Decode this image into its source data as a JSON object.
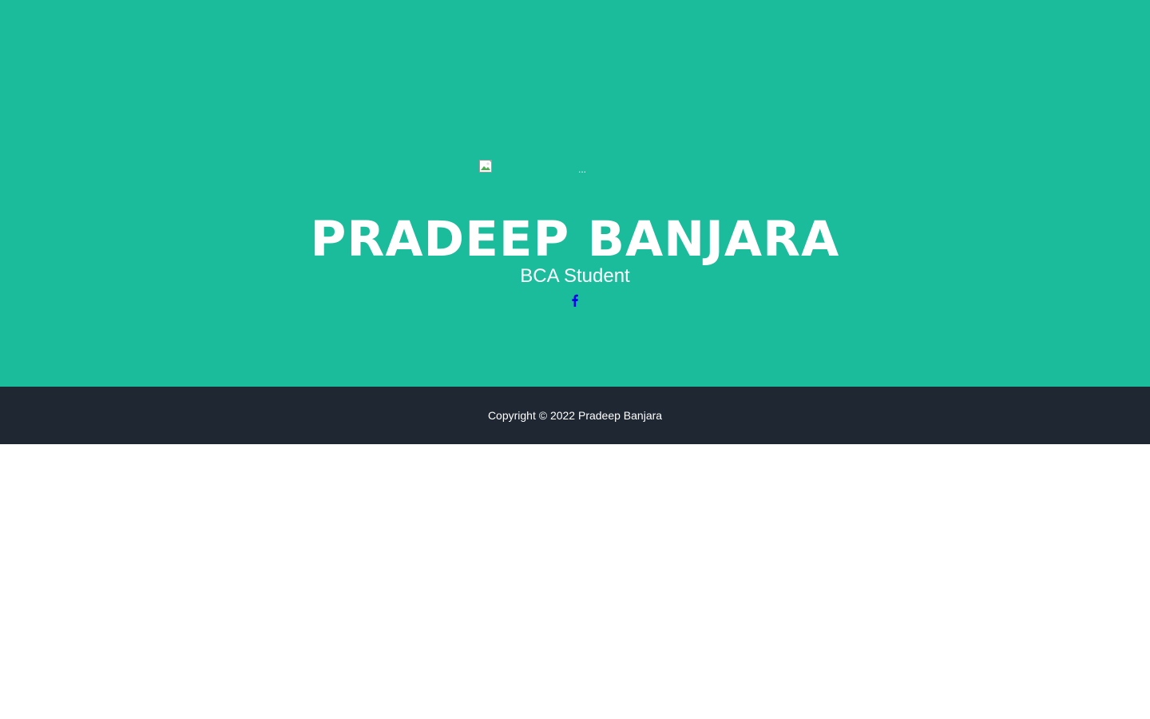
{
  "masthead": {
    "background_color": "#1abc9c",
    "avatar_alt": "...",
    "name": "PRADEEP BANJARA",
    "subtitle": "BCA Student",
    "social": [
      {
        "icon": "facebook-icon",
        "color": "#0000ee"
      }
    ]
  },
  "footer": {
    "background_color": "#1f2732",
    "copyright": "Copyright © 2022 Pradeep Banjara"
  }
}
